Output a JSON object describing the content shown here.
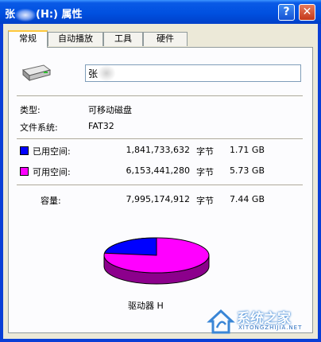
{
  "window": {
    "title_prefix": "张",
    "title_suffix": "(H:) 属性",
    "help_label": "?",
    "close_label": "✕"
  },
  "tabs": [
    {
      "label": "常规",
      "active": true
    },
    {
      "label": "自动播放",
      "active": false
    },
    {
      "label": "工具",
      "active": false
    },
    {
      "label": "硬件",
      "active": false
    }
  ],
  "general": {
    "drive_name_value": "张",
    "type_label": "类型:",
    "type_value": "可移动磁盘",
    "fs_label": "文件系统:",
    "fs_value": "FAT32",
    "used": {
      "label": "已用空间:",
      "bytes": "1,841,733,632",
      "unit": "字节",
      "size": "1.71 GB",
      "color": "#0000ff"
    },
    "free": {
      "label": "可用空间:",
      "bytes": "6,153,441,280",
      "unit": "字节",
      "size": "5.73 GB",
      "color": "#ff00ff"
    },
    "capacity": {
      "label": "容量:",
      "bytes": "7,995,174,912",
      "unit": "字节",
      "size": "7.44 GB"
    },
    "drive_caption": "驱动器 H",
    "used_fraction": 0.2304
  },
  "watermark": {
    "text": "系统之家",
    "sub": "XITONGZHIJIA.NET"
  }
}
